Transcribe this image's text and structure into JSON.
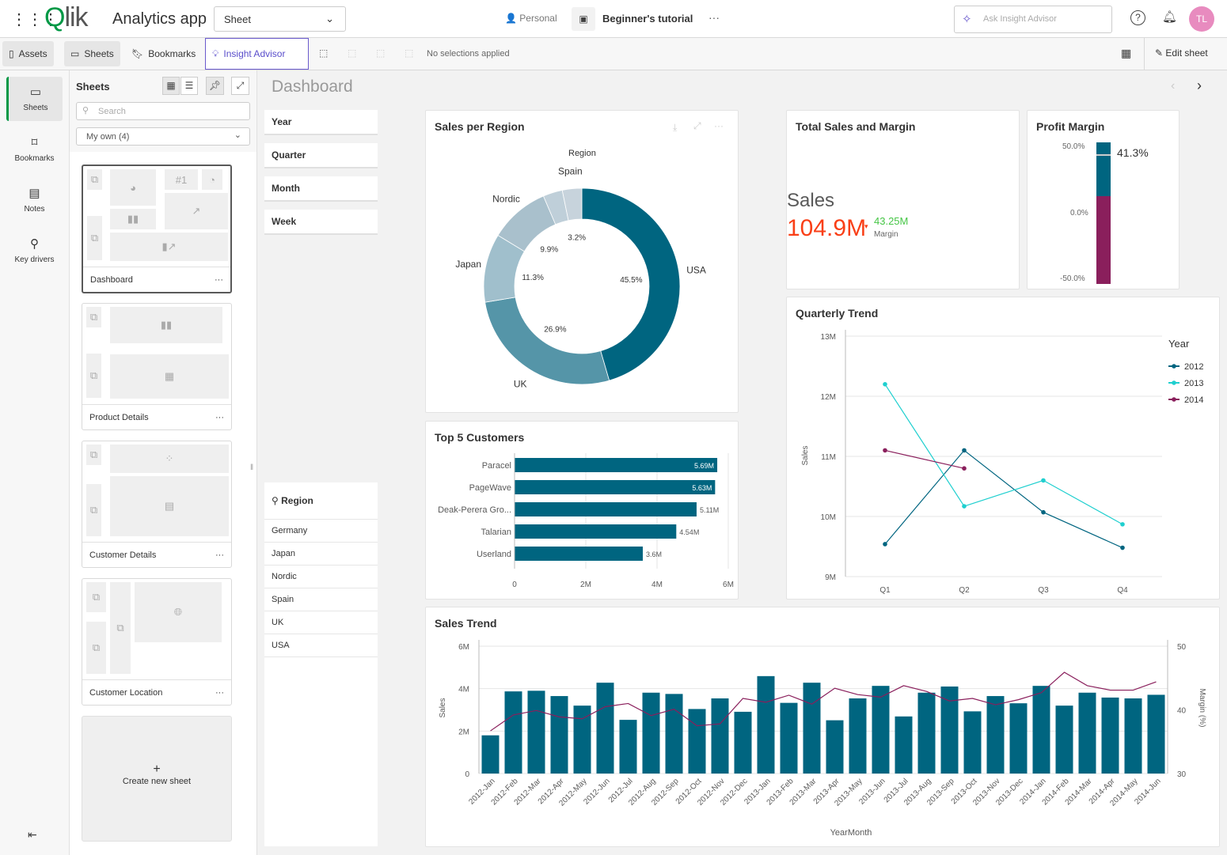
{
  "topbar": {
    "logo": "Qlik",
    "app_name": "Analytics app",
    "view_select": "Sheet",
    "space": "Personal",
    "tutorial": "Beginner's tutorial",
    "more": "···",
    "ask_placeholder": "Ask Insight Advisor",
    "avatar_initials": "TL",
    "avatar_color": "#e88bbf"
  },
  "toolbar": {
    "assets": "Assets",
    "sheets": "Sheets",
    "bookmarks": "Bookmarks",
    "insight_advisor": "Insight Advisor",
    "selections": "No selections applied",
    "edit_sheet": "Edit sheet"
  },
  "leftnav": {
    "items": [
      {
        "label": "Sheets"
      },
      {
        "label": "Bookmarks"
      },
      {
        "label": "Notes"
      },
      {
        "label": "Key drivers"
      }
    ]
  },
  "sheets_panel": {
    "title": "Sheets",
    "search_placeholder": "Search",
    "filter": "My own (4)",
    "sheets": [
      {
        "label": "Dashboard"
      },
      {
        "label": "Product Details"
      },
      {
        "label": "Customer Details"
      },
      {
        "label": "Customer Location"
      }
    ],
    "create_new": "Create new sheet",
    "more": "···"
  },
  "main": {
    "title": "Dashboard",
    "filters": [
      "Year",
      "Quarter",
      "Month",
      "Week"
    ],
    "region_filter": {
      "title": "Region",
      "values": [
        "Germany",
        "Japan",
        "Nordic",
        "Spain",
        "UK",
        "USA"
      ]
    }
  },
  "kpi": {
    "title": "Total Sales and Margin",
    "label": "Sales",
    "value": "104.9M",
    "value_color": "#f93f17",
    "secondary_value": "43.25M",
    "secondary_color": "#46c646",
    "secondary_label": "Margin"
  },
  "gauge": {
    "title": "Profit Margin",
    "value": 41.3,
    "value_label": "41.3%",
    "ticks": [
      "50.0%",
      "0.0%",
      "-50.0%"
    ],
    "range": [
      -50,
      50
    ]
  },
  "chart_data": [
    {
      "type": "pie",
      "title": "Sales per Region",
      "legend_title": "Region",
      "donut": true,
      "slices": [
        {
          "label": "USA",
          "value": 45.5,
          "value_label": "45.5%",
          "color": "#006580"
        },
        {
          "label": "UK",
          "value": 26.9,
          "value_label": "26.9%",
          "color": "#5595a8"
        },
        {
          "label": "Japan",
          "value": 11.3,
          "value_label": "11.3%",
          "color": "#a0bfcc"
        },
        {
          "label": "Nordic",
          "value": 9.9,
          "value_label": "9.9%",
          "color": "#a9c0cc"
        },
        {
          "label": "",
          "value": 3.2,
          "value_label": "",
          "color": "#bfcfd9"
        },
        {
          "label": "Spain",
          "value": 3.2,
          "value_label": "3.2%",
          "color": "#c7d3dc"
        }
      ]
    },
    {
      "type": "bar",
      "orientation": "horizontal",
      "title": "Top 5 Customers",
      "categories": [
        "Paracel",
        "PageWave",
        "Deak-Perera Gro...",
        "Talarian",
        "Userland"
      ],
      "values": [
        5.69,
        5.63,
        5.11,
        4.54,
        3.6
      ],
      "value_labels": [
        "5.69M",
        "5.63M",
        "5.11M",
        "4.54M",
        "3.6M"
      ],
      "xlim": [
        0,
        6
      ],
      "xticks": [
        "0",
        "2M",
        "4M",
        "6M"
      ],
      "color": "#006580"
    },
    {
      "type": "line",
      "title": "Quarterly Trend",
      "ylabel": "Sales",
      "legend_title": "Year",
      "legend": "right",
      "categories": [
        "Q1",
        "Q2",
        "Q3",
        "Q4"
      ],
      "ylim": [
        9,
        13
      ],
      "yticks": [
        "9M",
        "10M",
        "11M",
        "12M",
        "13M"
      ],
      "series": [
        {
          "name": "2012",
          "values": [
            9.54,
            11.1,
            10.07,
            9.48
          ],
          "color": "#006580"
        },
        {
          "name": "2013",
          "values": [
            12.2,
            10.17,
            10.6,
            9.87
          ],
          "color": "#1fcfcf"
        },
        {
          "name": "2014",
          "values": [
            11.1,
            10.8,
            null,
            null
          ],
          "color": "#8a1f5c"
        }
      ]
    },
    {
      "type": "bar",
      "title": "Sales Trend",
      "xlabel": "YearMonth",
      "ylabel": "Sales",
      "y2label": "Margin (%)",
      "ylim": [
        0,
        6
      ],
      "yticks": [
        "0",
        "2M",
        "4M",
        "6M"
      ],
      "y2lim": [
        30,
        50
      ],
      "y2ticks": [
        "30",
        "40",
        "50"
      ],
      "categories": [
        "2012-Jan",
        "2012-Feb",
        "2012-Mar",
        "2012-Apr",
        "2012-May",
        "2012-Jun",
        "2012-Jul",
        "2012-Aug",
        "2012-Sep",
        "2012-Oct",
        "2012-Nov",
        "2012-Dec",
        "2013-Jan",
        "2013-Feb",
        "2013-Mar",
        "2013-Apr",
        "2013-May",
        "2013-Jun",
        "2013-Jul",
        "2013-Aug",
        "2013-Sep",
        "2013-Oct",
        "2013-Nov",
        "2013-Dec",
        "2014-Jan",
        "2014-Feb",
        "2014-Mar",
        "2014-Apr",
        "2014-May",
        "2014-Jun"
      ],
      "series": [
        {
          "name": "Sales",
          "type": "bar",
          "color": "#006580",
          "values": [
            1.8,
            3.87,
            3.9,
            3.65,
            3.2,
            4.28,
            2.53,
            3.81,
            3.75,
            3.04,
            3.54,
            2.91,
            4.59,
            3.33,
            4.28,
            2.51,
            3.54,
            4.13,
            2.69,
            3.81,
            4.1,
            2.93,
            3.65,
            3.31,
            4.13,
            3.2,
            3.81,
            3.58,
            3.54,
            3.71
          ]
        },
        {
          "name": "Margin (%)",
          "type": "line",
          "color": "#8a1f5c",
          "values": [
            36.7,
            39.2,
            39.9,
            38.9,
            38.6,
            40.5,
            41.0,
            39.1,
            40.1,
            37.5,
            37.8,
            41.8,
            41.2,
            42.3,
            40.9,
            43.4,
            42.4,
            42.0,
            43.8,
            42.9,
            41.4,
            41.8,
            40.8,
            41.6,
            42.7,
            45.9,
            43.8,
            43.1,
            43.1,
            44.4
          ]
        }
      ]
    }
  ]
}
